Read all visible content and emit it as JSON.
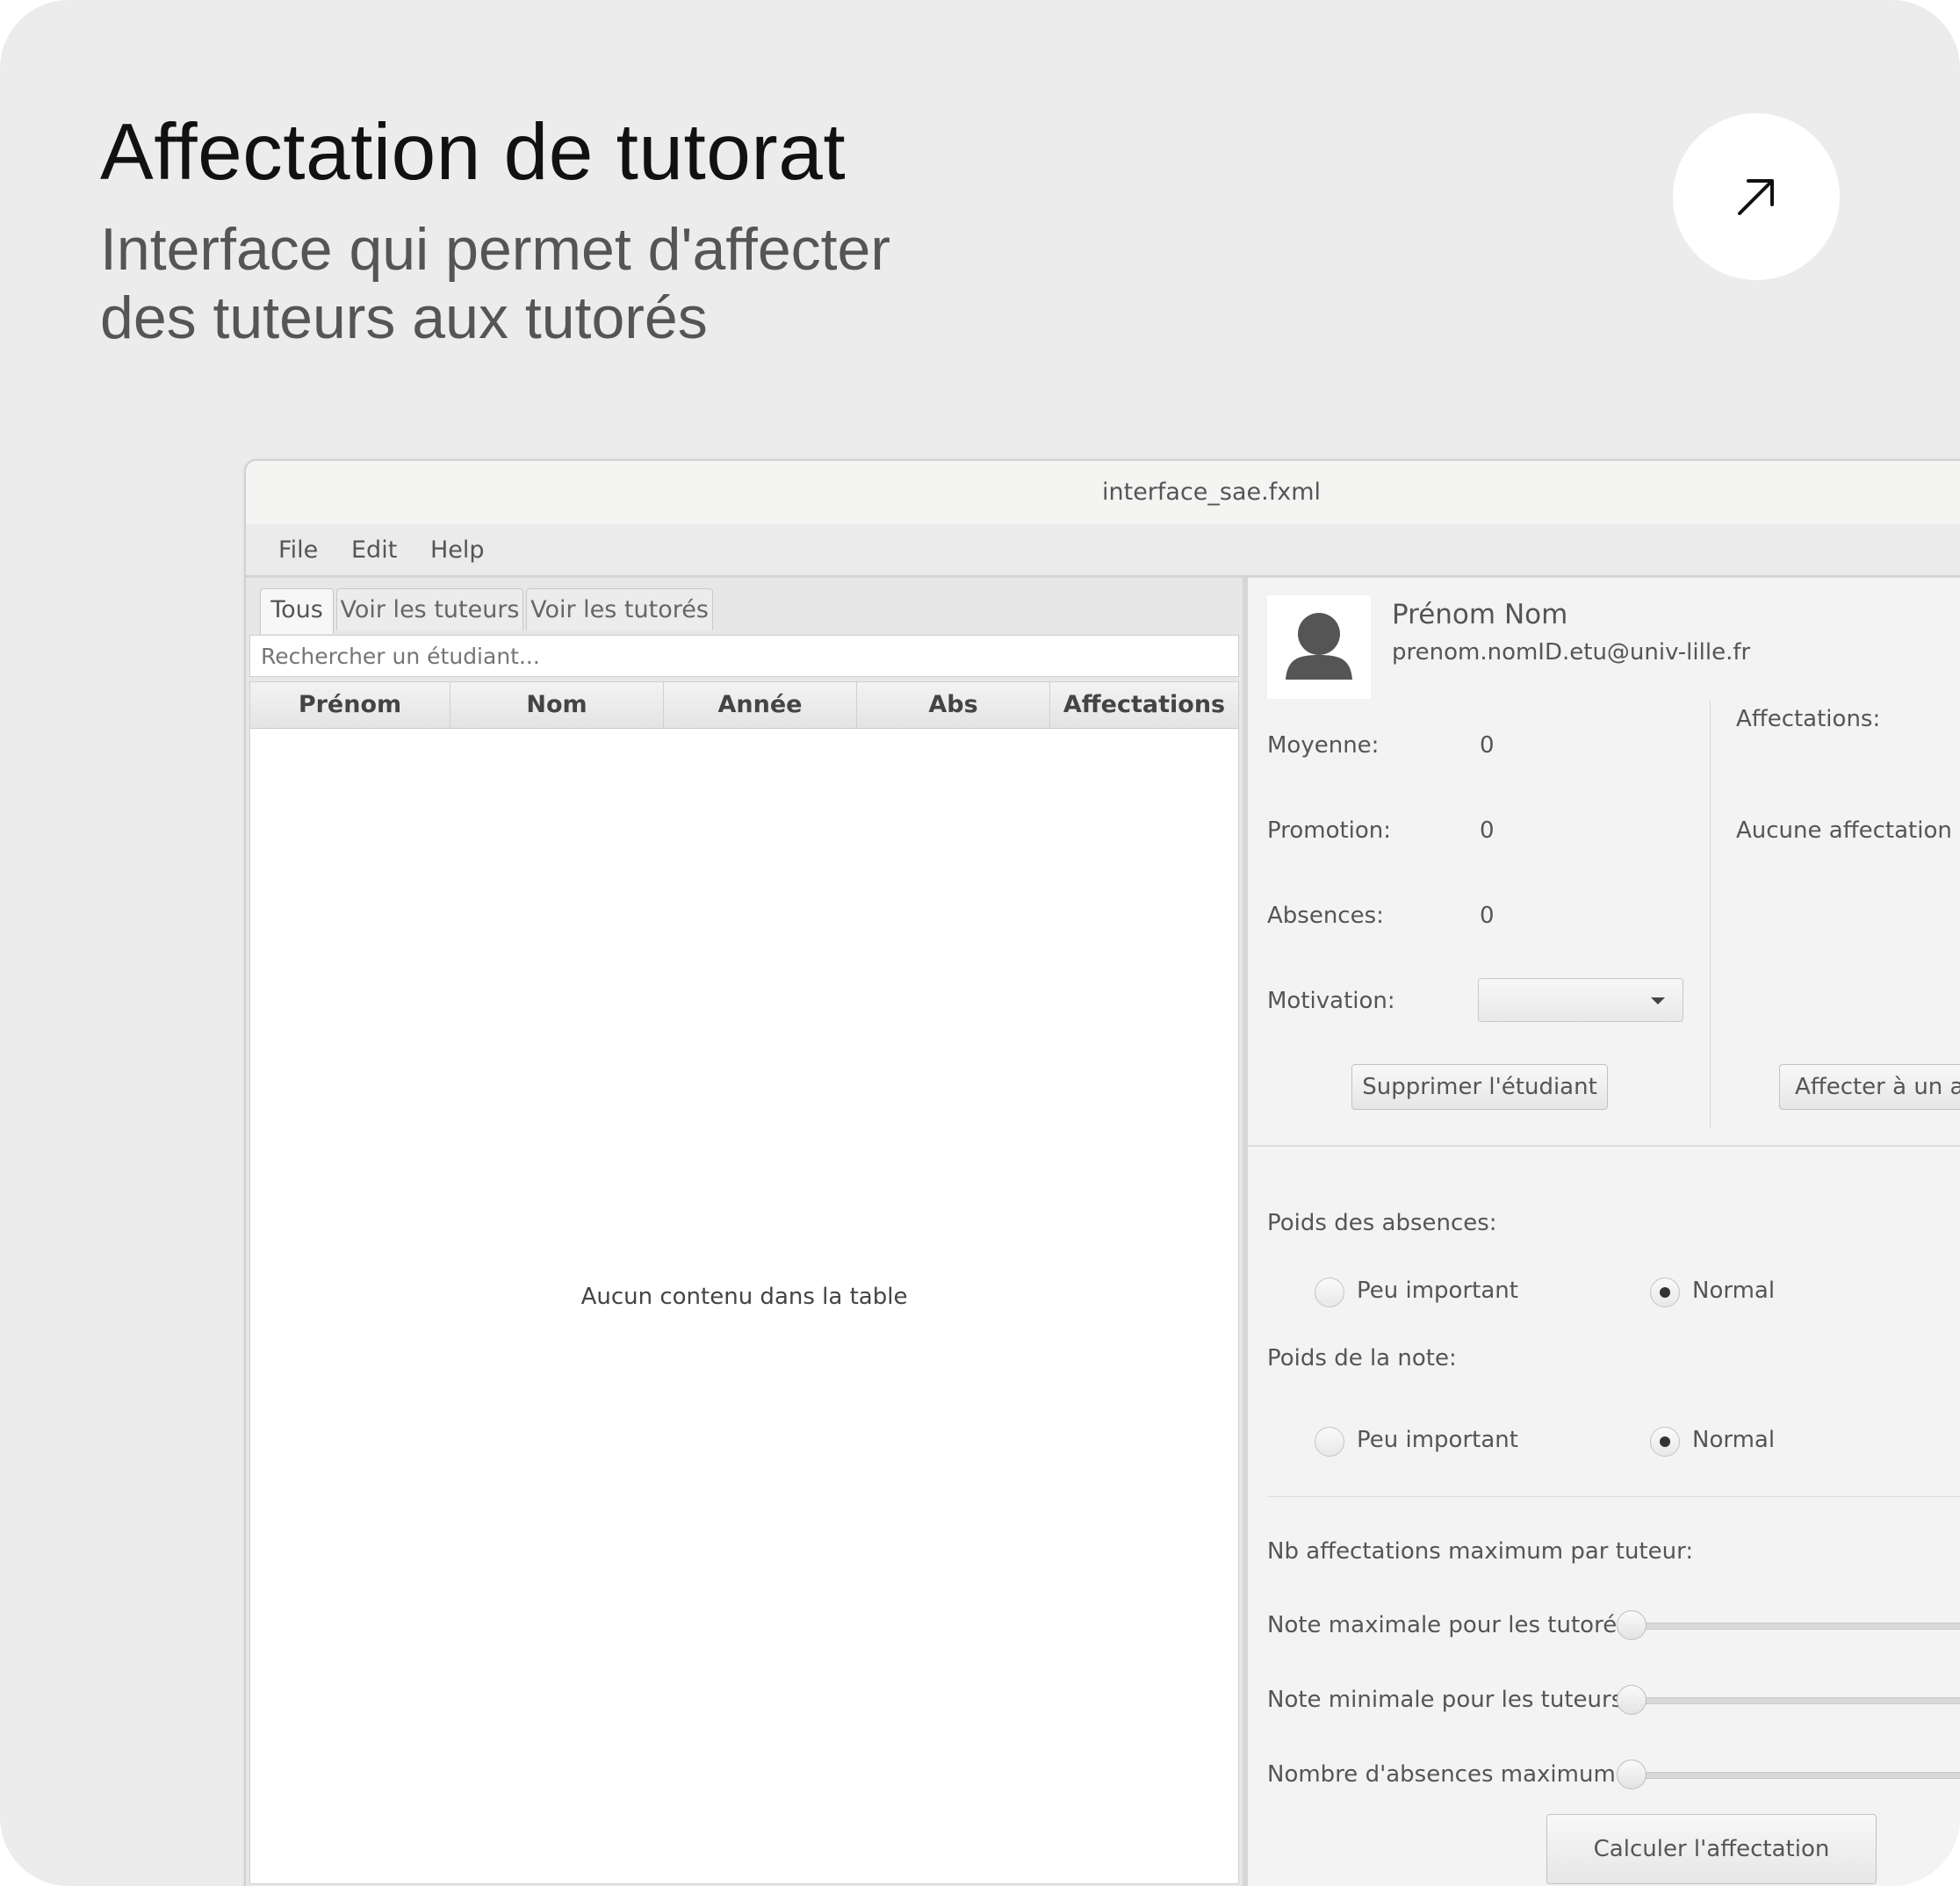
{
  "card": {
    "title": "Affectation de tutorat",
    "subtitle_line1": "Interface qui permet d'affecter",
    "subtitle_line2": "des tuteurs aux tutorés"
  },
  "window": {
    "title": "interface_sae.fxml",
    "menu": [
      "File",
      "Edit",
      "Help"
    ]
  },
  "left": {
    "tabs": [
      "Tous",
      "Voir les tuteurs",
      "Voir les tutorés"
    ],
    "search_placeholder": "Rechercher un étudiant...",
    "columns": [
      "Prénom",
      "Nom",
      "Année",
      "Abs",
      "Affectations"
    ],
    "empty_message": "Aucun contenu dans la table"
  },
  "student": {
    "name": "Prénom Nom",
    "email": "prenom.nomID.etu@univ-lille.fr",
    "moyenne_label": "Moyenne:",
    "moyenne_value": "0",
    "promotion_label": "Promotion:",
    "promotion_value": "0",
    "absences_label": "Absences:",
    "absences_value": "0",
    "motivation_label": "Motivation:",
    "motivation_value": "",
    "delete_button": "Supprimer l'étudiant",
    "affectations_label": "Affectations:",
    "affectations_value": "Aucune affectation",
    "assign_button": "Affecter à un au"
  },
  "weights": {
    "absences_label": "Poids des absences:",
    "note_label": "Poids de la note:",
    "option_low": "Peu important",
    "option_normal": "Normal",
    "absences_selected": "Normal",
    "note_selected": "Normal"
  },
  "limits": {
    "max_assign_label": "Nb affectations maximum par tuteur:",
    "max_tutored_grade_label": "Note maximale pour les tutorés:",
    "min_tutor_grade_label": "Note minimale pour les tuteurs:",
    "max_absences_label": "Nombre d'absences maximum:",
    "compute_button": "Calculer l'affectation"
  },
  "icons": {
    "open": "arrow-up-right-icon",
    "avatar": "user-silhouette-icon"
  }
}
